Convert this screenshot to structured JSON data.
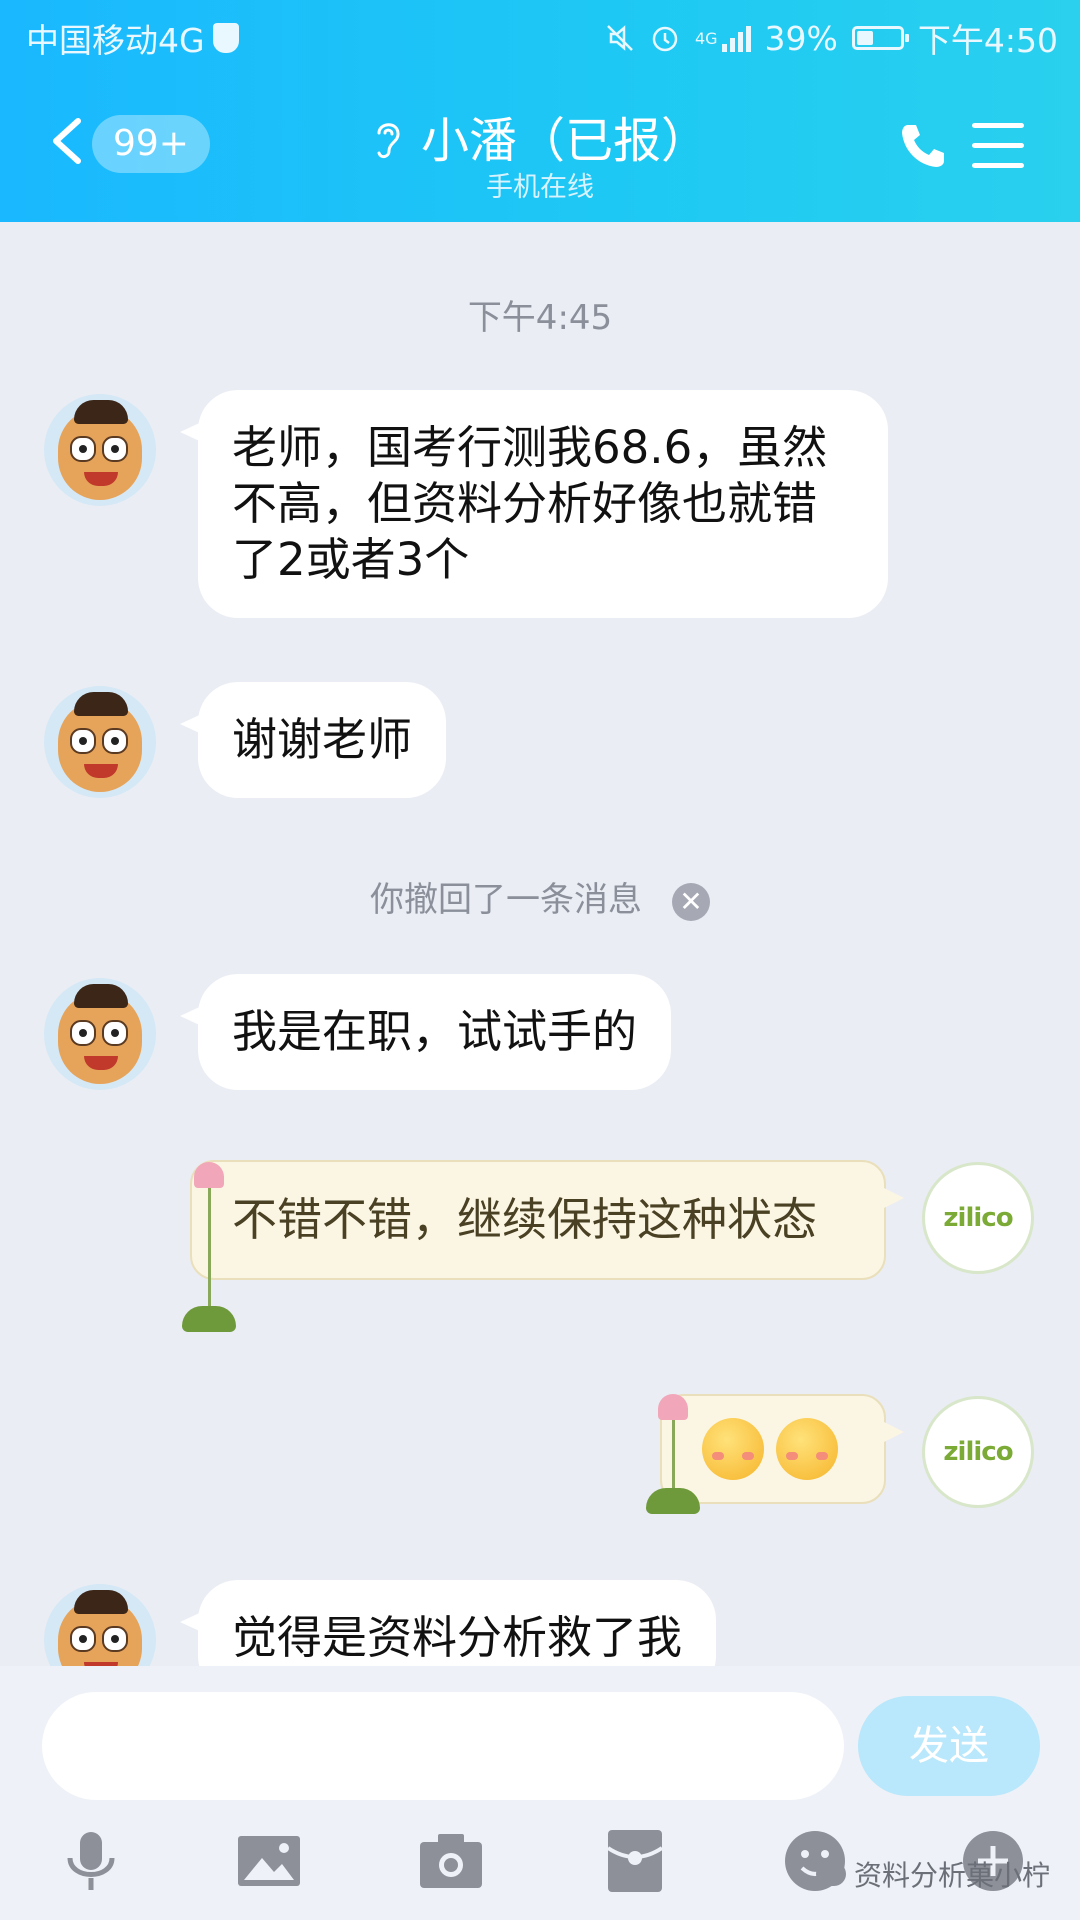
{
  "status_bar": {
    "carrier": "中国移动4G",
    "network": "4G",
    "battery": "39%",
    "battery_level": 0.39,
    "time": "下午4:50"
  },
  "header": {
    "unread_badge": "99+",
    "title": "小潘（已报）",
    "subtitle": "手机在线"
  },
  "chat": {
    "timestamp": "下午4:45",
    "messages": [
      {
        "text": "老师，国考行测我68.6，虽然不高，但资料分析好像也就错了2或者3个"
      },
      {
        "text": "谢谢老师"
      },
      {
        "text": "我是在职，试试手的"
      },
      {
        "text": "不错不错，继续保持这种状态"
      },
      {
        "text": "觉得是资料分析救了我"
      }
    ],
    "recall_notice": "你撤回了一条消息",
    "my_avatar_text": "zilico"
  },
  "input": {
    "placeholder": "",
    "send_label": "发送"
  },
  "watermark": "资料分析菓小柠",
  "colors": {
    "header": "#1ec9f3",
    "background": "#eaedf4",
    "lotus_bubble": "#fbf6e3"
  }
}
